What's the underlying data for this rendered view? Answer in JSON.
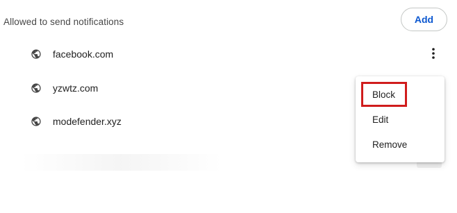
{
  "section": {
    "title": "Allowed to send notifications",
    "add_label": "Add"
  },
  "sites": [
    {
      "name": "facebook.com",
      "icon": "globe-icon"
    },
    {
      "name": "yzwtz.com",
      "icon": "globe-icon"
    },
    {
      "name": "modefender.xyz",
      "icon": "globe-icon"
    }
  ],
  "menu": {
    "items": [
      {
        "label": "Block",
        "highlighted": true
      },
      {
        "label": "Edit"
      },
      {
        "label": "Remove"
      }
    ]
  },
  "colors": {
    "accent": "#0b57d0",
    "highlight_border": "#d01c1c",
    "icon": "#474747",
    "text": "#1f1f1f"
  }
}
